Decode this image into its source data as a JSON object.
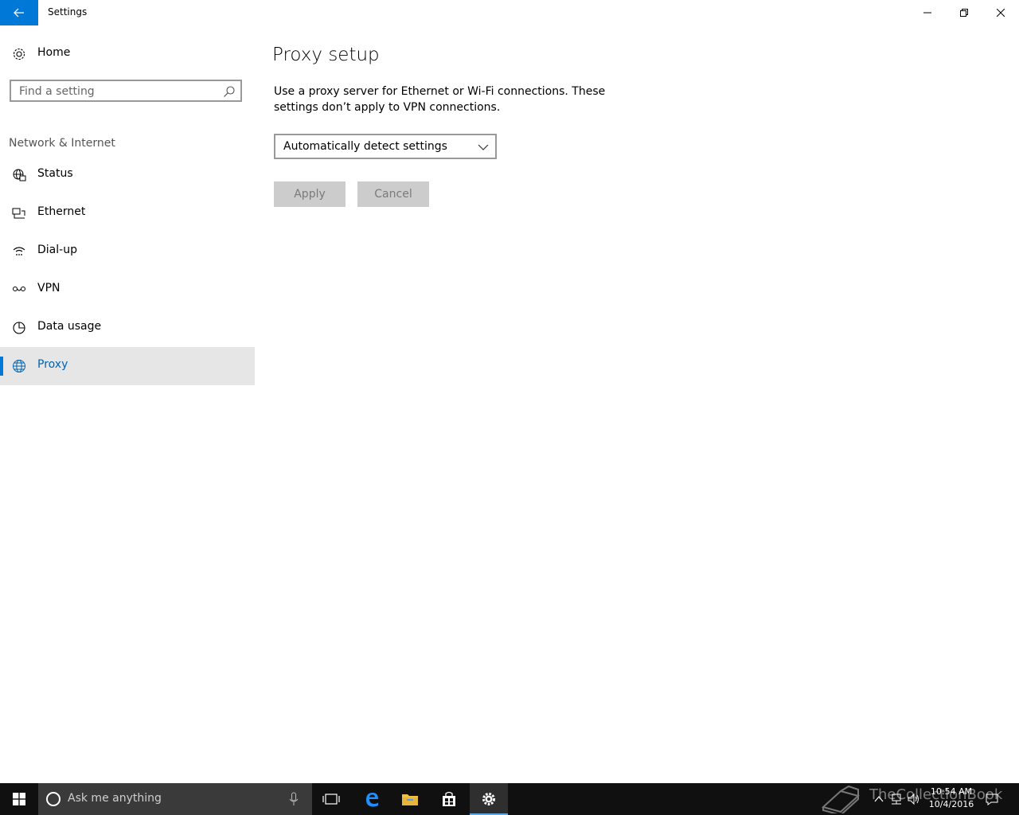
{
  "window": {
    "title": "Settings"
  },
  "sidebar": {
    "home_label": "Home",
    "search_placeholder": "Find a setting",
    "section_label": "Network & Internet",
    "items": [
      {
        "label": "Status",
        "icon": "globe-status-icon"
      },
      {
        "label": "Ethernet",
        "icon": "ethernet-icon"
      },
      {
        "label": "Dial-up",
        "icon": "dialup-icon"
      },
      {
        "label": "VPN",
        "icon": "vpn-icon"
      },
      {
        "label": "Data usage",
        "icon": "data-usage-icon"
      },
      {
        "label": "Proxy",
        "icon": "globe-icon",
        "selected": true
      }
    ]
  },
  "main": {
    "title": "Proxy setup",
    "description": "Use a proxy server for Ethernet or Wi-Fi connections. These settings don’t apply to VPN connections.",
    "dropdown_value": "Automatically detect settings",
    "apply_label": "Apply",
    "cancel_label": "Cancel"
  },
  "taskbar": {
    "search_placeholder": "Ask me anything",
    "time": "10:54 AM",
    "date": "10/4/2016",
    "watermark": "TheCollectionBook"
  },
  "colors": {
    "accent": "#0078d7",
    "selected_bg": "#e6e6e6",
    "taskbar_bg": "#101010",
    "button_disabled_bg": "#cccccc"
  }
}
